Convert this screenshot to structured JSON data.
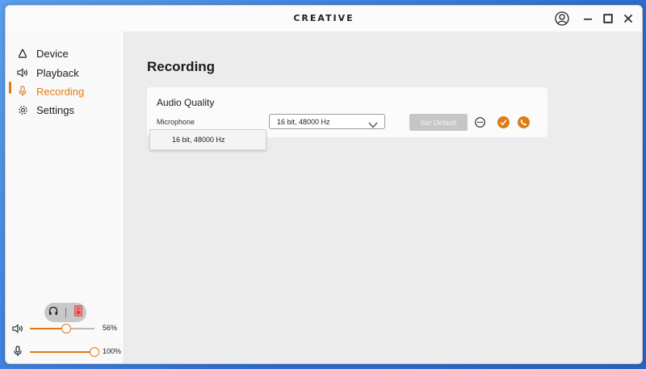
{
  "app": {
    "brand": "CREATIVE"
  },
  "sidebar": {
    "items": [
      {
        "label": "Device",
        "icon": "device-icon"
      },
      {
        "label": "Playback",
        "icon": "speaker-icon"
      },
      {
        "label": "Recording",
        "icon": "microphone-icon",
        "active": true
      },
      {
        "label": "Settings",
        "icon": "gear-icon"
      }
    ],
    "output_toggle": {
      "options": [
        "headphones-icon",
        "speaker-icon"
      ],
      "selected": "speaker-icon"
    },
    "volume": {
      "value": "56%",
      "level": 0.56
    },
    "mic_level": {
      "value": "100%",
      "level": 1.0
    }
  },
  "main": {
    "title": "Recording",
    "audio_quality": {
      "heading": "Audio Quality",
      "field_label": "Microphone",
      "selected": "16 bit, 48000 Hz",
      "options": [
        "16 bit, 48000 Hz"
      ],
      "set_default_label": "Set Default"
    }
  },
  "colors": {
    "accent": "#e07b12",
    "disabled": "#c6c6c6"
  }
}
